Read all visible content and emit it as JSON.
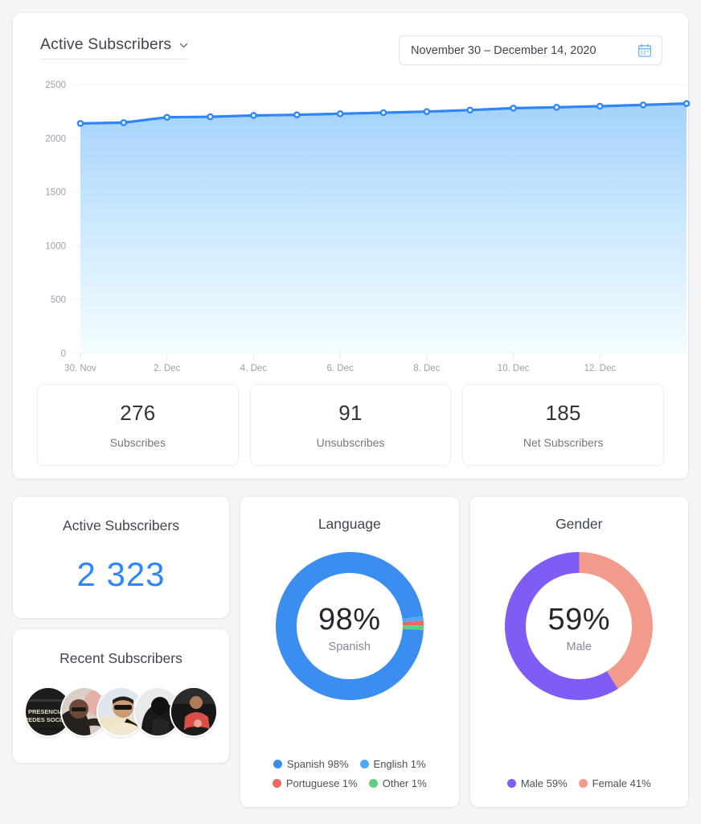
{
  "header": {
    "title": "Active Subscribers",
    "dropdown_icon": "chevron-down-icon",
    "date_range": "November 30 – December 14, 2020",
    "calendar_icon": "calendar-icon"
  },
  "stats": [
    {
      "value": "276",
      "label": "Subscribes"
    },
    {
      "value": "91",
      "label": "Unsubscribes"
    },
    {
      "value": "185",
      "label": "Net Subscribers"
    }
  ],
  "active_subscribers_card": {
    "title": "Active Subscribers",
    "value": "2 323"
  },
  "recent_subscribers_card": {
    "title": "Recent Subscribers",
    "avatar_count": 5
  },
  "language_card": {
    "title": "Language",
    "center_pct": "98%",
    "center_label": "Spanish",
    "legend": [
      {
        "label": "Spanish 98%",
        "color": "#3b8ef0"
      },
      {
        "label": "English 1%",
        "color": "#4fa9f5"
      },
      {
        "label": "Portuguese 1%",
        "color": "#f0655c"
      },
      {
        "label": "Other 1%",
        "color": "#5fd080"
      }
    ]
  },
  "gender_card": {
    "title": "Gender",
    "center_pct": "59%",
    "center_label": "Male",
    "legend": [
      {
        "label": "Male 59%",
        "color": "#7f5cf4"
      },
      {
        "label": "Female 41%",
        "color": "#f29b8d"
      }
    ]
  },
  "chart_data": {
    "type": "area",
    "title": "Active Subscribers",
    "xlabel": "",
    "ylabel": "",
    "ylim": [
      0,
      2500
    ],
    "yticks": [
      0,
      500,
      1000,
      1500,
      2000,
      2500
    ],
    "ytick_labels": [
      "0",
      "500",
      "1000",
      "1500",
      "2000",
      "2500"
    ],
    "xtick_labels": [
      "30. Nov",
      "2. Dec",
      "4. Dec",
      "6. Dec",
      "8. Dec",
      "10. Dec",
      "12. Dec"
    ],
    "grid": true,
    "legend_position": "none",
    "line_color": "#2e86ff",
    "fill_gradient": [
      "#a9d5fb",
      "#f3fbff"
    ],
    "x": [
      "30. Nov",
      "1. Dec",
      "2. Dec",
      "3. Dec",
      "4. Dec",
      "5. Dec",
      "6. Dec",
      "7. Dec",
      "8. Dec",
      "9. Dec",
      "10. Dec",
      "11. Dec",
      "12. Dec",
      "13. Dec",
      "14. Dec"
    ],
    "series": [
      {
        "name": "Active Subscribers",
        "values": [
          2138,
          2145,
          2195,
          2200,
          2212,
          2218,
          2228,
          2238,
          2248,
          2262,
          2280,
          2288,
          2298,
          2310,
          2323
        ]
      }
    ]
  },
  "language_chart": {
    "type": "pie",
    "title": "Language",
    "labels": [
      "Spanish",
      "English",
      "Portuguese",
      "Other"
    ],
    "values": [
      98,
      1,
      1,
      1
    ],
    "colors": [
      "#3b8ef0",
      "#4fa9f5",
      "#f0655c",
      "#5fd080"
    ]
  },
  "gender_chart": {
    "type": "pie",
    "title": "Gender",
    "labels": [
      "Male",
      "Female"
    ],
    "values": [
      59,
      41
    ],
    "colors": [
      "#7f5cf4",
      "#f29b8d"
    ]
  }
}
